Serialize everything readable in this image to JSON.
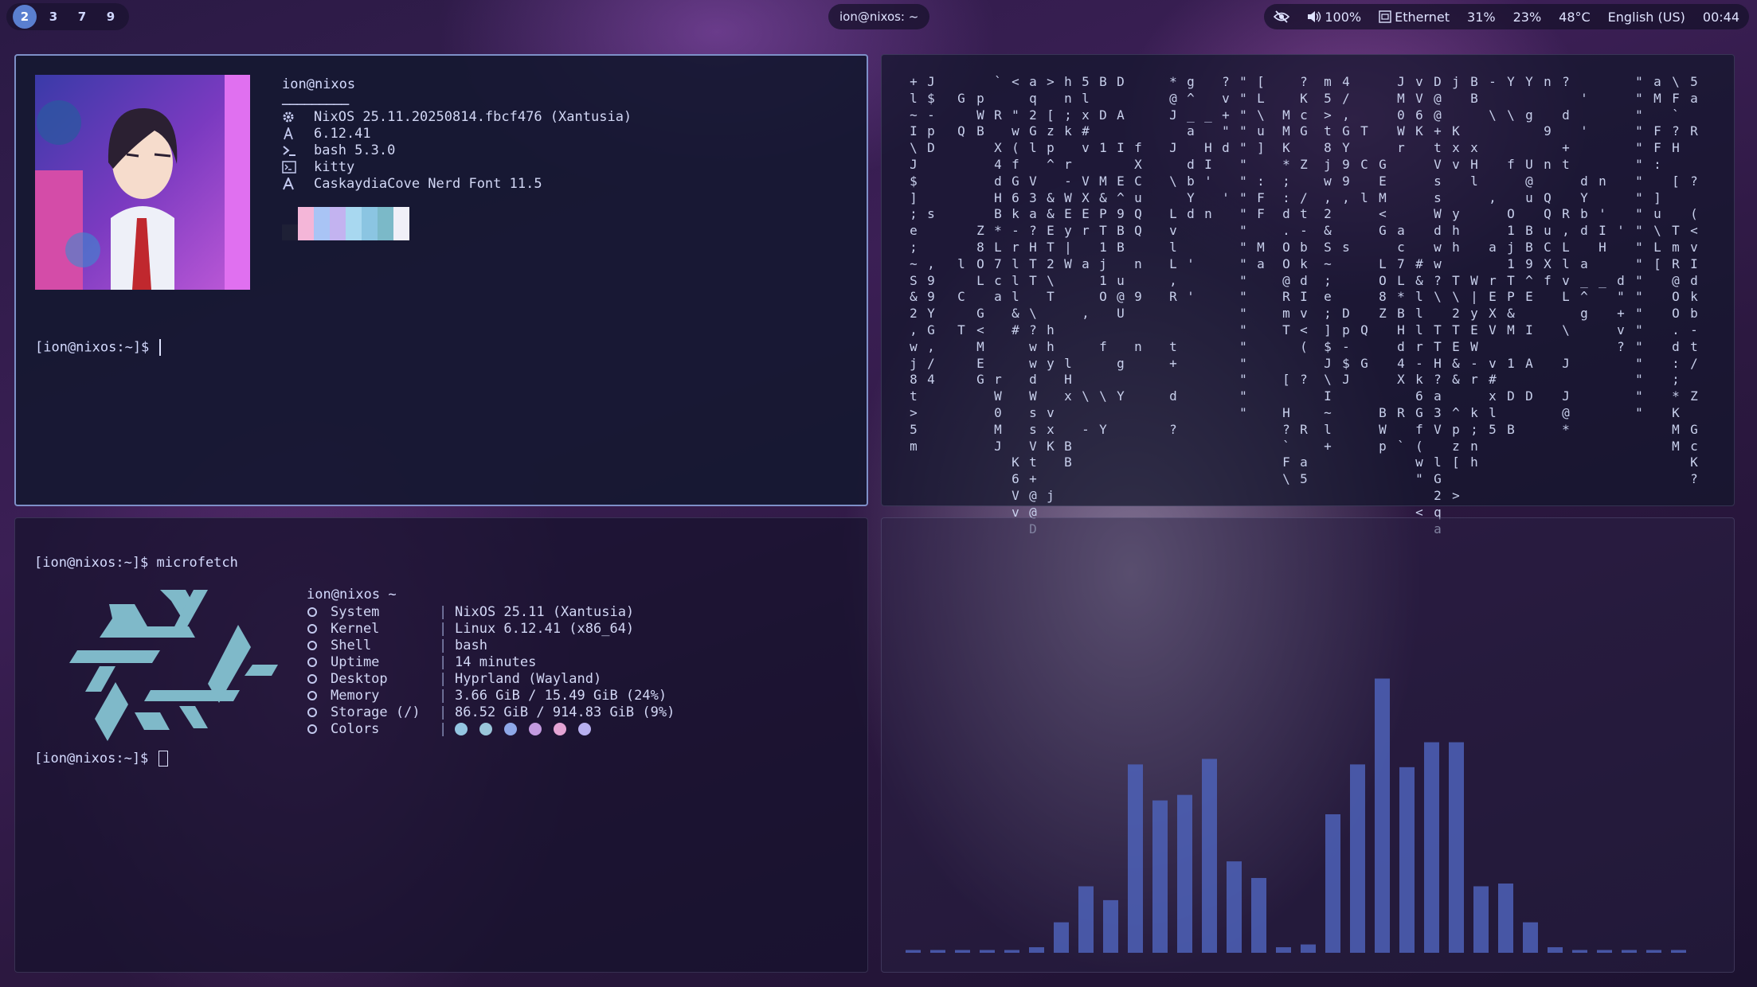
{
  "topbar": {
    "workspaces": [
      "2",
      "3",
      "7",
      "9"
    ],
    "active_workspace": "2",
    "window_title": "ion@nixos: ~",
    "status": {
      "volume": "100%",
      "network": "Ethernet",
      "cpu": "31%",
      "memory": "23%",
      "temp": "48°C",
      "keyboard": "English (US)",
      "clock": "00:44"
    }
  },
  "fastfetch": {
    "user": "ion@nixos",
    "separator": "─────────",
    "os": "NixOS 25.11.20250814.fbcf476 (Xantusia)",
    "kernel": "6.12.41",
    "shell": "bash 5.3.0",
    "terminal": "kitty",
    "font": "CaskaydiaCove Nerd Font 11.5",
    "palette": [
      "#1e2036",
      "#f4b6d8",
      "#a9c4f5",
      "#c3b3f0",
      "#a8d8f0",
      "#8bc5e2",
      "#7bb9c8",
      "#f0f0f8"
    ],
    "prompt": "[ion@nixos:~]$ "
  },
  "matrix": {
    "columns": [
      "+l~I\\J$];e;~S&2,wj8t>5m",
      "J$-pD   s  ,99YG,/4",
      " G Q       l C T   ",
      " pWB     Z8OL G<MEG     ",
      "` R X4dHB*L7ca    rW0MJ",
      "< \"w(fG6k-rlll&#       K6Vv",
      "aq2Gl V3a?HTT \\?wwdWssVt+@@D",
      "> [zp^ &&ET2\\T hhy  vxK  j",
      "hn;k r-WEy|W     lHx  BB",
      "5lx#v VXEr a  ,    \\ -",
      "B D 1 M&PT1j1O  f  \\ Y",
      "D A I E^9BB u@U  g Y",
      "    fXCuQQ n 9  n",
      "*@J J \\ LvlL,R  t+ d ?",
      "g^_a dbYd  ' ' ",
      "  _ HI' n      ",
      "?v+\"d  '         ",
      "\"\"\"\"\"\"\"\"\"\"\"\"\"\"\"\"\"\"\"\"\"",
      "[L\\u] :FF Ma",
      "  MMK*;:d.OO@RmT  [ H?`F\\",
      "?KcG Z /t-bkdIv<( ?  R a5"
    ],
    "chars": "+lI\\J$];e;~S&2,wj8t>5m"
  },
  "microfetch": {
    "command_prompt": "[ion@nixos:~]$ ",
    "command": "microfetch",
    "header": "ion@nixos ~",
    "rows": [
      {
        "label": "System",
        "value": "NixOS 25.11 (Xantusia)"
      },
      {
        "label": "Kernel",
        "value": "Linux 6.12.41 (x86_64)"
      },
      {
        "label": "Shell",
        "value": "bash"
      },
      {
        "label": "Uptime",
        "value": "14 minutes"
      },
      {
        "label": "Desktop",
        "value": "Hyprland (Wayland)"
      },
      {
        "label": "Memory",
        "value": "3.66 GiB / 15.49 GiB (24%)"
      },
      {
        "label": "Storage (/)",
        "value": "86.52 GiB / 914.83 GiB (9%)"
      },
      {
        "label": "Colors",
        "value": ""
      }
    ],
    "colors": [
      "#94c6e2",
      "#9ac6da",
      "#8ea8e8",
      "#c39ae0",
      "#e4a4d4",
      "#b8b0f0"
    ],
    "separator": "|",
    "prompt": "[ion@nixos:~]$ "
  },
  "visualizer": {
    "bar_color": "#4d62b8",
    "levels": [
      0.01,
      0.01,
      0.01,
      0.01,
      0.01,
      0.02,
      0.11,
      0.24,
      0.19,
      0.68,
      0.55,
      0.57,
      0.7,
      0.33,
      0.27,
      0.02,
      0.03,
      0.5,
      0.68,
      0.99,
      0.67,
      0.76,
      0.76,
      0.24,
      0.25,
      0.11,
      0.02,
      0.01,
      0.01,
      0.01,
      0.01,
      0.01
    ]
  }
}
